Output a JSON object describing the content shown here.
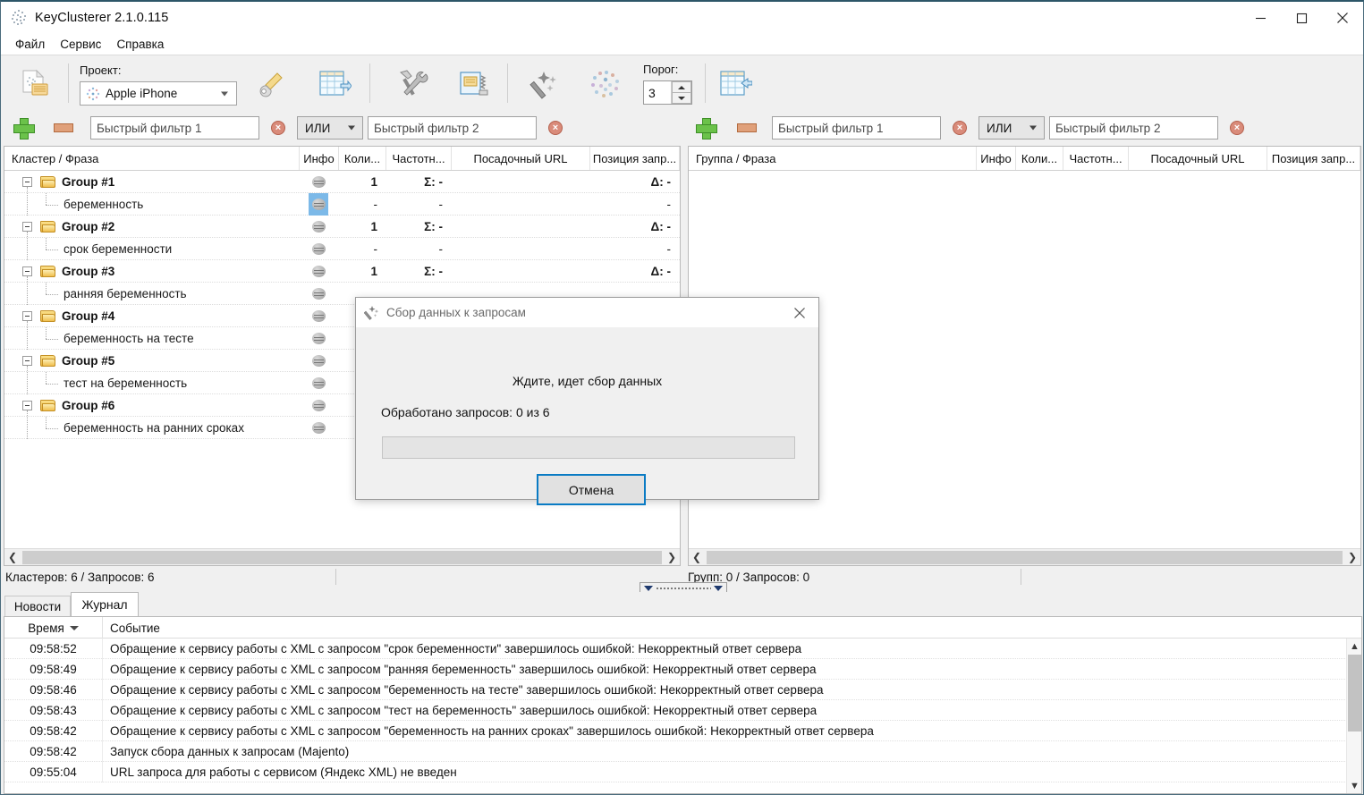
{
  "window": {
    "title": "KeyClusterer 2.1.0.115",
    "app_icon": "cluster-dots-icon",
    "controls": {
      "minimize": "minimize-icon",
      "maximize": "maximize-icon",
      "close": "close-icon"
    }
  },
  "menu": {
    "items": [
      "Файл",
      "Сервис",
      "Справка"
    ]
  },
  "toolbar": {
    "new_project_icon": "new-project-icon",
    "project_label": "Проект:",
    "project_value": "Apple iPhone",
    "settings_icon": "wrench-icon",
    "import_table_icon": "import-table-icon",
    "tools_icon": "hammer-wrench-icon",
    "compress_icon": "archive-icon",
    "magic_icon": "magic-wand-icon",
    "cluster_icon": "cluster-scatter-icon",
    "threshold_label": "Порог:",
    "threshold_value": "3",
    "export_table_icon": "export-table-icon"
  },
  "filters": {
    "add_icon": "plus-icon",
    "remove_icon": "minus-icon",
    "clear_icon": "clear-circle-icon",
    "input1_placeholder": "Быстрый фильтр 1",
    "input2_placeholder": "Быстрый фильтр 2",
    "operator": "ИЛИ"
  },
  "left_panel": {
    "columns": [
      "Кластер / Фраза",
      "Инфо",
      "Коли...",
      "Частотн...",
      "Посадочный URL",
      "Позиция запр..."
    ],
    "rows": [
      {
        "type": "group",
        "name": "Group #1",
        "count": "1",
        "freq": "Σ: -",
        "url": "",
        "pos": "Δ: -"
      },
      {
        "type": "phrase",
        "name": "беременность",
        "count": "-",
        "freq": "-",
        "url": "",
        "pos": "-"
      },
      {
        "type": "group",
        "name": "Group #2",
        "count": "1",
        "freq": "Σ: -",
        "url": "",
        "pos": "Δ: -"
      },
      {
        "type": "phrase",
        "name": "срок беременности",
        "count": "-",
        "freq": "-",
        "url": "",
        "pos": "-"
      },
      {
        "type": "group",
        "name": "Group #3",
        "count": "1",
        "freq": "Σ: -",
        "url": "",
        "pos": "Δ: -"
      },
      {
        "type": "phrase",
        "name": "ранняя беременность",
        "count": "",
        "freq": "",
        "url": "",
        "pos": ""
      },
      {
        "type": "group",
        "name": "Group #4",
        "count": "",
        "freq": "",
        "url": "",
        "pos": ""
      },
      {
        "type": "phrase",
        "name": "беременность на тесте",
        "count": "",
        "freq": "",
        "url": "",
        "pos": ""
      },
      {
        "type": "group",
        "name": "Group #5",
        "count": "",
        "freq": "",
        "url": "",
        "pos": ""
      },
      {
        "type": "phrase",
        "name": "тест на беременность",
        "count": "",
        "freq": "",
        "url": "",
        "pos": ""
      },
      {
        "type": "group",
        "name": "Group #6",
        "count": "",
        "freq": "",
        "url": "",
        "pos": ""
      },
      {
        "type": "phrase",
        "name": "беременность на ранних сроках",
        "count": "",
        "freq": "",
        "url": "",
        "pos": ""
      }
    ],
    "status": "Кластеров: 6 / Запросов: 6"
  },
  "right_panel": {
    "columns": [
      "Группа / Фраза",
      "Инфо",
      "Коли...",
      "Частотн...",
      "Посадочный URL",
      "Позиция запр..."
    ],
    "rows": [],
    "status": "Групп: 0 / Запросов: 0"
  },
  "bottom_tabs": {
    "tabs": [
      "Новости",
      "Журнал"
    ],
    "active": "Журнал"
  },
  "log": {
    "columns": [
      "Время",
      "Событие"
    ],
    "sort_indicator": "sort-desc-icon",
    "rows": [
      {
        "time": "09:58:52",
        "event": "Обращение к сервису работы с XML с запросом \"срок беременности\" завершилось ошибкой: Некорректный ответ сервера"
      },
      {
        "time": "09:58:49",
        "event": "Обращение к сервису работы с XML с запросом \"ранняя беременность\" завершилось ошибкой: Некорректный ответ сервера"
      },
      {
        "time": "09:58:46",
        "event": "Обращение к сервису работы с XML с запросом \"беременность на тесте\" завершилось ошибкой: Некорректный ответ сервера"
      },
      {
        "time": "09:58:43",
        "event": "Обращение к сервису работы с XML с запросом \"тест на беременность\" завершилось ошибкой: Некорректный ответ сервера"
      },
      {
        "time": "09:58:42",
        "event": "Обращение к сервису работы с XML с запросом \"беременность на ранних сроках\" завершилось ошибкой: Некорректный ответ сервера"
      },
      {
        "time": "09:58:42",
        "event": "Запуск сбора данных к запросам (Majento)"
      },
      {
        "time": "09:55:04",
        "event": "URL запроса для работы с сервисом (Яндекс XML) не введен"
      }
    ]
  },
  "dialog": {
    "icon": "magic-wand-icon",
    "title": "Сбор данных к запросам",
    "close_icon": "close-icon",
    "message": "Ждите, идет сбор данных",
    "progress_text": "Обработано запросов: 0 из 6",
    "progress_percent": 0,
    "cancel_label": "Отмена"
  },
  "colors": {
    "accent_blue": "#0a7bc4",
    "selection": "#7cb9e8",
    "window_border": "#4a6b7c",
    "toolbar_bg": "#f0f0f0"
  }
}
